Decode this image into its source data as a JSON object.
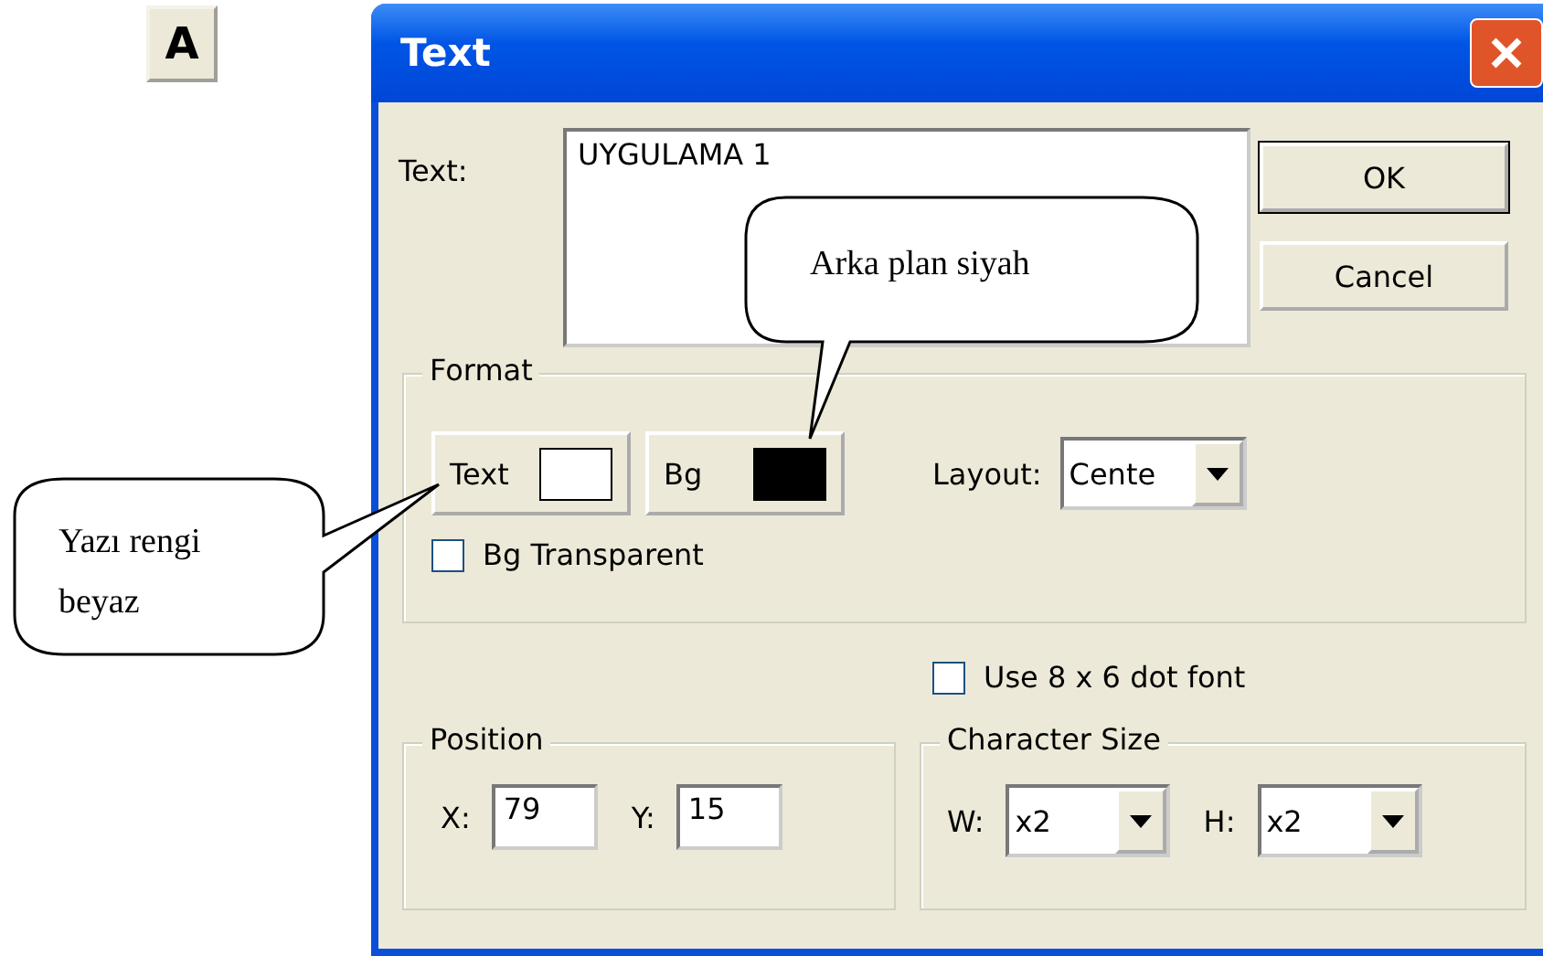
{
  "toolbar_button": {
    "label": "A"
  },
  "window": {
    "title": "Text"
  },
  "text_field": {
    "label": "Text:",
    "value": "UYGULAMA 1"
  },
  "buttons": [
    "OK",
    "Cancel"
  ],
  "format": {
    "title": "Format",
    "text_color": {
      "label": "Text",
      "color": "#ffffff"
    },
    "bg_color": {
      "label": "Bg",
      "color": "#000000"
    },
    "layout": {
      "label": "Layout:",
      "value": "Cente"
    },
    "bg_transparent": {
      "label": "Bg Transparent",
      "checked": false
    }
  },
  "dot_font": {
    "label": "Use 8 x 6 dot font",
    "checked": false
  },
  "position": {
    "title": "Position",
    "x": {
      "label": "X:",
      "value": "79"
    },
    "y": {
      "label": "Y:",
      "value": "15"
    }
  },
  "character_size": {
    "title": "Character Size",
    "w": {
      "label": "W:",
      "value": "x2"
    },
    "h": {
      "label": "H:",
      "value": "x2"
    }
  },
  "callouts": [
    {
      "text": "Arka plan siyah"
    },
    {
      "text": "Yazı rengi beyaz"
    }
  ]
}
